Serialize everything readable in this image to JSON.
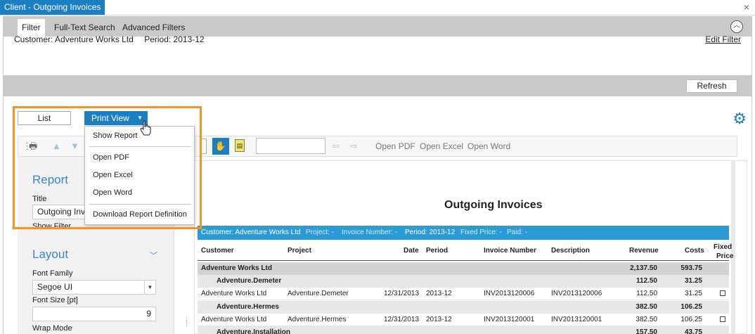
{
  "window": {
    "title": "Client - Outgoing Invoices",
    "close": "×"
  },
  "tabs": [
    {
      "label": "Filter"
    },
    {
      "label": "Full-Text Search"
    },
    {
      "label": "Advanced Filters"
    }
  ],
  "filter": {
    "customer": "Customer: Adventure Works Ltd",
    "period": "Period: 2013-12",
    "edit": "Edit Filter"
  },
  "refresh_label": "Refresh",
  "view": {
    "list": "List",
    "print": "Print View"
  },
  "print_menu": {
    "items": [
      "Show Report",
      "Open PDF",
      "Open Excel",
      "Open Word",
      "Download Report Definition"
    ]
  },
  "toolbar": {
    "open_pdf": "Open PDF",
    "open_excel": "Open Excel",
    "open_word": "Open Word"
  },
  "side_panel": {
    "report_head": "Report",
    "title_label": "Title",
    "title_value": "Outgoing Invo",
    "show_filter": "Show Filter",
    "layout_head": "Layout",
    "font_family_label": "Font Family",
    "font_family_value": "Segoe UI",
    "font_size_label": "Font Size [pt]",
    "font_size_value": "9",
    "wrap_mode_label": "Wrap Mode"
  },
  "report": {
    "title": "Outgoing Invoices",
    "header_bar": {
      "customer": "Customer: Adventure Works Ltd",
      "project": "Project: -",
      "invoice": "Invoice Number: -",
      "period": "Period: 2013-12",
      "fixed": "Fixed Price: -",
      "paid": "Paid: -"
    },
    "columns": [
      "Customer",
      "Project",
      "Date",
      "Period",
      "Invoice Number",
      "Description",
      "Revenue",
      "Costs",
      "Fixed",
      "Price"
    ],
    "groups": [
      {
        "name": "Adventure Works Ltd",
        "revenue": "2,137.50",
        "costs": "593.75"
      },
      {
        "name": "Adventure.Demeter",
        "revenue": "112.50",
        "costs": "31.25"
      },
      {
        "name": "Adventure.Hermes",
        "revenue": "382.50",
        "costs": "106.25"
      },
      {
        "name": "Adventure.Installation",
        "revenue": "157.50",
        "costs": "43.75"
      }
    ],
    "rows": [
      {
        "customer": "Adventure Works Ltd",
        "project": "Adventure.Demeter",
        "date": "12/31/2013",
        "period": "2013-12",
        "invoice": "INV2013120006",
        "description": "INV2013120006",
        "revenue": "112.50",
        "costs": "31.25"
      },
      {
        "customer": "Adventure Works Ltd",
        "project": "Adventure.Hermes",
        "date": "12/31/2013",
        "period": "2013-12",
        "invoice": "INV2013120001",
        "description": "INV2013120001",
        "revenue": "382.50",
        "costs": "106.25"
      }
    ]
  },
  "colors": {
    "accent": "#1b7fc1",
    "highlight": "#f7941d",
    "report_bar": "#2b9bd5"
  }
}
